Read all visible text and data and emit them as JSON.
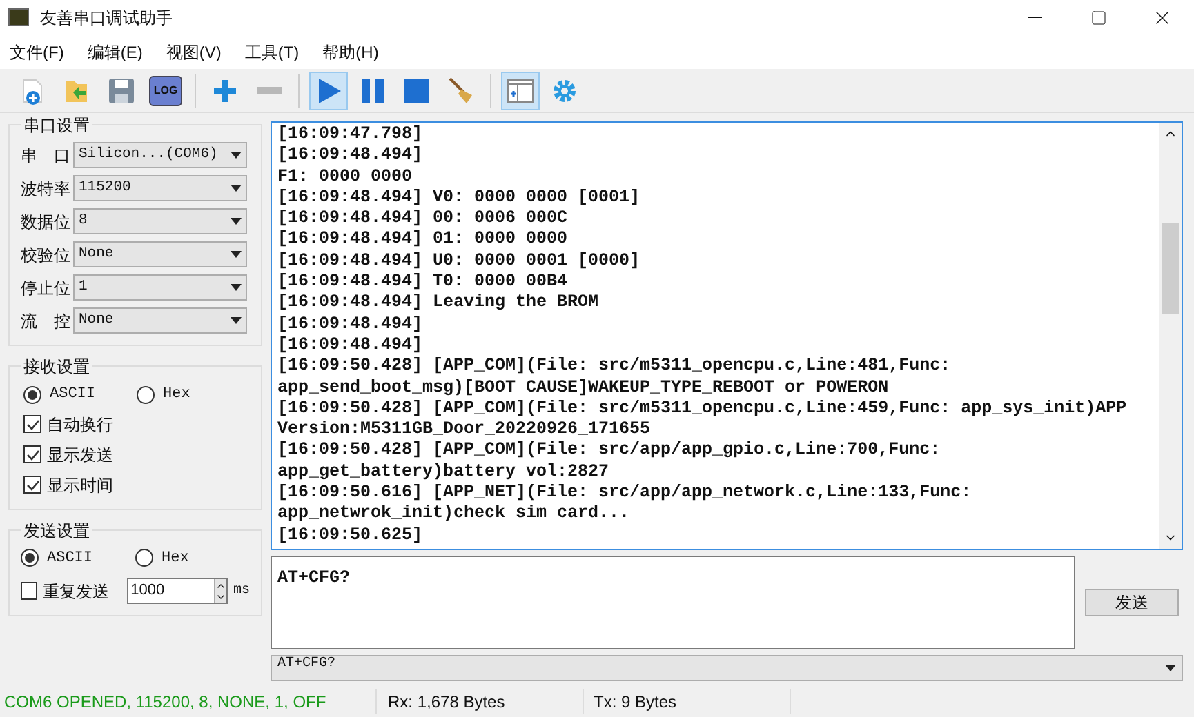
{
  "window": {
    "title": "友善串口调试助手"
  },
  "menu": [
    "文件(F)",
    "编辑(E)",
    "视图(V)",
    "工具(T)",
    "帮助(H)"
  ],
  "toolbar": [
    {
      "kind": "new",
      "selected": false
    },
    {
      "kind": "open",
      "selected": false
    },
    {
      "kind": "save",
      "selected": false
    },
    {
      "kind": "log",
      "label": "LOG",
      "selected": false
    },
    {
      "kind": "sep"
    },
    {
      "kind": "add",
      "selected": false
    },
    {
      "kind": "remove",
      "selected": false
    },
    {
      "kind": "sep"
    },
    {
      "kind": "play",
      "selected": true
    },
    {
      "kind": "pause",
      "selected": false
    },
    {
      "kind": "stop",
      "selected": false
    },
    {
      "kind": "broom",
      "selected": false
    },
    {
      "kind": "sep"
    },
    {
      "kind": "window",
      "selected": true
    },
    {
      "kind": "gear",
      "selected": false
    }
  ],
  "serial_settings": {
    "title": "串口设置",
    "fields": [
      {
        "label": "串　口",
        "value": "Silicon...(COM6)"
      },
      {
        "label": "波特率",
        "value": "115200"
      },
      {
        "label": "数据位",
        "value": "8"
      },
      {
        "label": "校验位",
        "value": "None"
      },
      {
        "label": "停止位",
        "value": "1"
      },
      {
        "label": "流　控",
        "value": "None"
      }
    ]
  },
  "receive_settings": {
    "title": "接收设置",
    "modes": [
      {
        "label": "ASCII",
        "selected": true
      },
      {
        "label": "Hex",
        "selected": false
      }
    ],
    "options": [
      {
        "label": "自动换行",
        "checked": true
      },
      {
        "label": "显示发送",
        "checked": true
      },
      {
        "label": "显示时间",
        "checked": true
      }
    ]
  },
  "send_settings": {
    "title": "发送设置",
    "modes": [
      {
        "label": "ASCII",
        "selected": true
      },
      {
        "label": "Hex",
        "selected": false
      }
    ],
    "repeat": {
      "label": "重复发送",
      "checked": false,
      "value": "1000",
      "unit": "ms"
    }
  },
  "log": [
    "[16:09:47.798]",
    "[16:09:48.494]",
    "F1: 0000 0000",
    "[16:09:48.494] V0: 0000 0000 [0001]",
    "[16:09:48.494] 00: 0006 000C",
    "[16:09:48.494] 01: 0000 0000",
    "[16:09:48.494] U0: 0000 0001 [0000]",
    "[16:09:48.494] T0: 0000 00B4",
    "[16:09:48.494] Leaving the BROM",
    "[16:09:48.494]",
    "[16:09:48.494]",
    "[16:09:50.428] [APP_COM](File: src/m5311_opencpu.c,Line:481,Func:",
    "app_send_boot_msg)[BOOT CAUSE]WAKEUP_TYPE_REBOOT or POWERON",
    "[16:09:50.428] [APP_COM](File: src/m5311_opencpu.c,Line:459,Func: app_sys_init)APP",
    "Version:M5311GB_Door_20220926_171655",
    "[16:09:50.428] [APP_COM](File: src/app/app_gpio.c,Line:700,Func:",
    "app_get_battery)battery vol:2827",
    "[16:09:50.616] [APP_NET](File: src/app/app_network.c,Line:133,Func:",
    "app_netwrok_init)check sim card...",
    "[16:09:50.625]"
  ],
  "send_input": {
    "value": "AT+CFG?"
  },
  "send_button": "发送",
  "history": {
    "value": "AT+CFG?"
  },
  "status_bar": {
    "port": "COM6 OPENED, 115200, 8, NONE, 1, OFF",
    "rx": "Rx: 1,678 Bytes",
    "tx": "Tx: 9 Bytes"
  }
}
